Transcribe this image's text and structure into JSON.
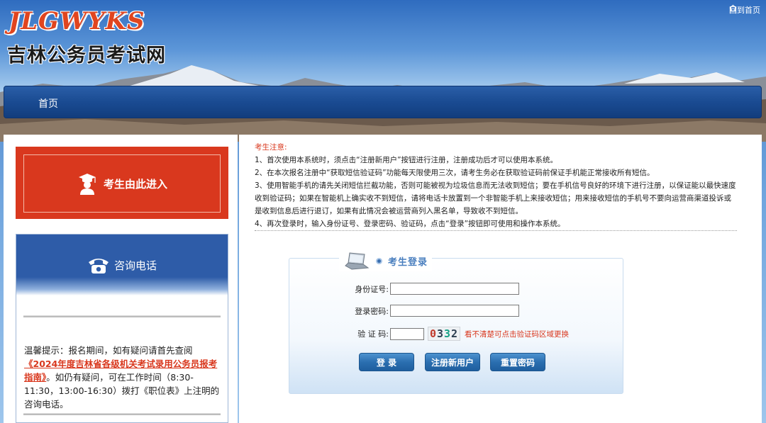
{
  "header": {
    "logo_en": "JLGWYKS",
    "logo_cn": "吉林公务员考试网",
    "home_link": "回到首页"
  },
  "nav": {
    "items": [
      {
        "label": "首页"
      }
    ]
  },
  "left": {
    "enter_label": "考生由此进入",
    "phone_label": "咨询电话",
    "tips_prefix": "温馨提示：报名期间，如有疑问请首先查阅",
    "tips_link": "《2024年度吉林省各级机关考试录用公务员报考指南》",
    "tips_suffix": "。如仍有疑问，可在工作时间（8:30-11:30，13:00-16:30）拨打《职位表》上注明的咨询电话。"
  },
  "notice": {
    "title": "考生注意:",
    "items": [
      "1、首次使用本系统时，须点击“注册新用户”按钮进行注册，注册成功后才可以使用本系统。",
      "2、在本次报名注册中“获取短信验证码”功能每天限使用三次，请考生务必在获取验证码前保证手机能正常接收所有短信。",
      "3、使用智能手机的请先关闭短信拦截功能，否则可能被视为垃圾信息而无法收到短信；要在手机信号良好的环境下进行注册，以保证能以最快速度收到验证码；如果在智能机上确实收不到短信，请将电话卡放置到一个非智能手机上来接收短信；用来接收短信的手机号不要向运营商渠道投诉或是收到信息后进行退订，如果有此情况会被运营商列入黑名单，导致收不到短信。",
      "4、再次登录时，输入身份证号、登录密码、验证码，点击“登录”按钮即可使用和操作本系统。"
    ]
  },
  "login": {
    "title": "考生登录",
    "id_label": "身份证号:",
    "id_value": "",
    "password_label": "登录密码:",
    "password_value": "",
    "captcha_label": "验 证 码:",
    "captcha_value": "",
    "captcha_digits": [
      "0",
      "3",
      "3",
      "2"
    ],
    "captcha_hint": "看不清楚可点击验证码区域更换",
    "login_button": "登 录",
    "register_button": "注册新用户",
    "reset_button": "重置密码"
  },
  "colors": {
    "accent_red": "#d9381e",
    "nav_blue": "#1a4b92",
    "button_blue": "#2b6fb0"
  },
  "icons": {
    "home": "home-icon",
    "student": "student-icon",
    "phone": "phone-icon",
    "laptop": "laptop-icon"
  }
}
